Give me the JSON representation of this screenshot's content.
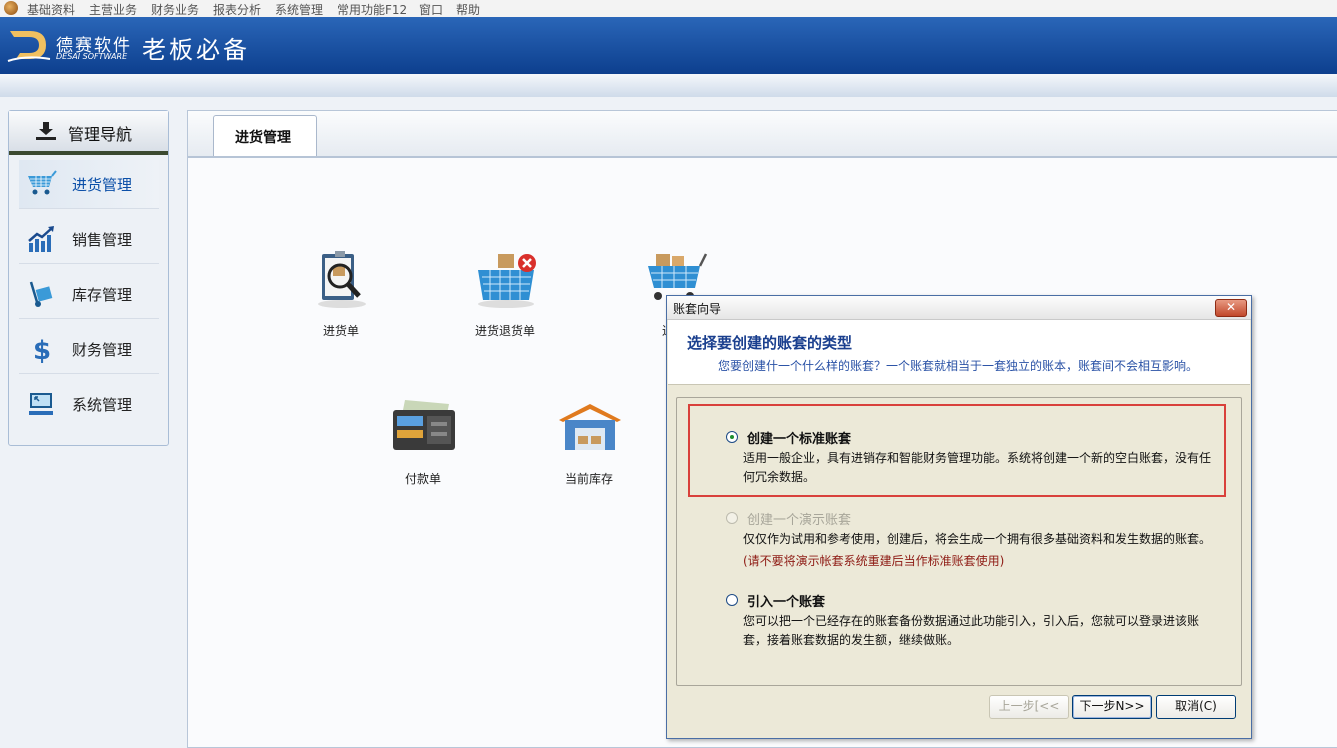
{
  "menubar": {
    "items": [
      "基础资料",
      "主营业务",
      "财务业务",
      "报表分析",
      "系统管理",
      "常用功能F12",
      "窗口",
      "帮助"
    ]
  },
  "banner": {
    "brand_cn": "德赛软件",
    "brand_en": "DESAI SOFTWARE",
    "product": "老板必备"
  },
  "sidebar": {
    "title": "管理导航",
    "items": [
      {
        "label": "进货管理",
        "icon": "shopping-cart-icon"
      },
      {
        "label": "销售管理",
        "icon": "sales-chart-icon"
      },
      {
        "label": "库存管理",
        "icon": "hand-truck-icon"
      },
      {
        "label": "财务管理",
        "icon": "dollar-icon"
      },
      {
        "label": "系统管理",
        "icon": "monitor-icon"
      }
    ]
  },
  "main": {
    "tab": "进货管理",
    "functions": [
      {
        "label": "进货单",
        "icon": "clipboard-magnifier-icon"
      },
      {
        "label": "进货退货单",
        "icon": "basket-return-icon"
      },
      {
        "label": "进货",
        "icon": "cart-goods-icon"
      },
      {
        "label": "付款单",
        "icon": "cash-register-icon"
      },
      {
        "label": "当前库存",
        "icon": "warehouse-icon"
      }
    ]
  },
  "dialog": {
    "title": "账套向导",
    "close_label": "✕",
    "header_title": "选择要创建的账套的类型",
    "header_sub": "您要创建什一个什么样的账套？一个账套就相当于一套独立的账本，账套间不会相互影响。",
    "options": [
      {
        "title": "创建一个标准账套",
        "desc": "适用一般企业，具有进销存和智能财务管理功能。系统将创建一个新的空白账套，没有任何冗余数据。",
        "checked": true,
        "disabled": false
      },
      {
        "title": "创建一个演示账套",
        "desc": "仅仅作为试用和参考使用，创建后，将会生成一个拥有很多基础资料和发生数据的账套。",
        "warn": "(请不要将演示帐套系统重建后当作标准账套使用)",
        "checked": false,
        "disabled": true
      },
      {
        "title": "引入一个账套",
        "desc": "您可以把一个已经存在的账套备份数据通过此功能引入，引入后，您就可以登录进该账套，接着账套数据的发生额，继续做账。",
        "checked": false,
        "disabled": false
      }
    ],
    "buttons": {
      "prev": "上一步[<<",
      "next": "下一步N>>",
      "cancel": "取消(C)"
    }
  }
}
